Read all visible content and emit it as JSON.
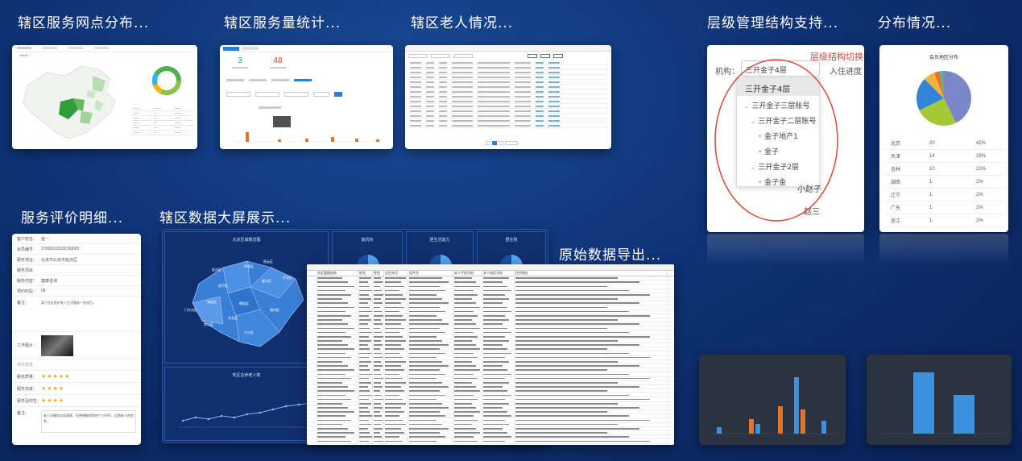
{
  "titles": {
    "service_points": "辖区服务网点分布...",
    "service_volume": "辖区服务量统计...",
    "elderly": "辖区老人情况...",
    "hierarchy": "层级管理结构支持...",
    "distribution": "分布情况...",
    "evaluation": "服务评价明细...",
    "bigscreen": "辖区数据大屏展示...",
    "export": "原始数据导出..."
  },
  "volume_card": {
    "stat1_value": "3",
    "stat2_value": "48"
  },
  "hierarchy_card": {
    "switch_label": "层级结构切换",
    "org_label": "机构：",
    "selected": "三开金子4层",
    "progress_label": "入住进度",
    "tree": [
      "三开金子4层",
      "三开金子三层账号",
      "三开金子二层账号",
      "金子地产1",
      "金子",
      "三开金子2层",
      "金子金"
    ],
    "behind_1": "小赵子",
    "behind_2": "赵三"
  },
  "distribution_card": {
    "chart_title": "会员地区分布",
    "rows": [
      {
        "name": "北京",
        "count": "20",
        "pct": "42%"
      },
      {
        "name": "天津",
        "count": "14",
        "pct": "29%"
      },
      {
        "name": "吉林",
        "count": "10",
        "pct": "21%"
      },
      {
        "name": "湖南",
        "count": "1",
        "pct": "2%"
      },
      {
        "name": "辽宁",
        "count": "1",
        "pct": "2%"
      },
      {
        "name": "广东",
        "count": "1",
        "pct": "2%"
      },
      {
        "name": "浙江",
        "count": "1",
        "pct": "2%"
      }
    ]
  },
  "evaluation_card": {
    "fields": [
      {
        "k": "客户姓名：",
        "v": "金一"
      },
      {
        "k": "会员编号：",
        "v": "17060210315700002"
      },
      {
        "k": "服务地址：",
        "v": "北京市北京市延庆区"
      },
      {
        "k": "服务项目",
        "v": ""
      },
      {
        "k": "服务内容：",
        "v": "健康咨询"
      },
      {
        "k": "预约时段：",
        "v": "08"
      }
    ],
    "note_label": "备注：",
    "note_text": "某于社区医护老人生活服务一些项目...",
    "image_label": "工作图片：",
    "section": "评价信息",
    "ratings": [
      {
        "k": "服务质量：",
        "stars": 5
      },
      {
        "k": "服务态度：",
        "stars": 4
      },
      {
        "k": "服务及时性：",
        "stars": 4
      }
    ],
    "remark_label": "备注：",
    "remark_text": "老人对服务比较满意，但希望能找到给个小时内，近期老人的信息。"
  },
  "bigscreen_card": {
    "map_title": "北京区域概览图",
    "p1_title": "能机构",
    "p2_title": "居生活能力",
    "p3_title": "居住则",
    "line_title": "地区总养老人数",
    "districts": [
      "怀柔区",
      "密云区",
      "延庆区",
      "昌平区",
      "顺义区",
      "平谷区",
      "海淀区",
      "朝阳区",
      "门头沟区",
      "通州区",
      "丰台区",
      "房山区",
      "大兴区"
    ]
  },
  "export_card": {
    "headers": [
      "社区管理机构",
      "姓名",
      "性别",
      "出生年月",
      "证件号",
      "本人手机号码",
      "本人电话号码",
      "住宅地址"
    ],
    "row_count": 40
  },
  "colors": {
    "bg": "#0e3275",
    "accent": "#2d7fd0",
    "orange": "#e8722a",
    "red_circle": "#e0453a",
    "green": "#4caf50"
  }
}
